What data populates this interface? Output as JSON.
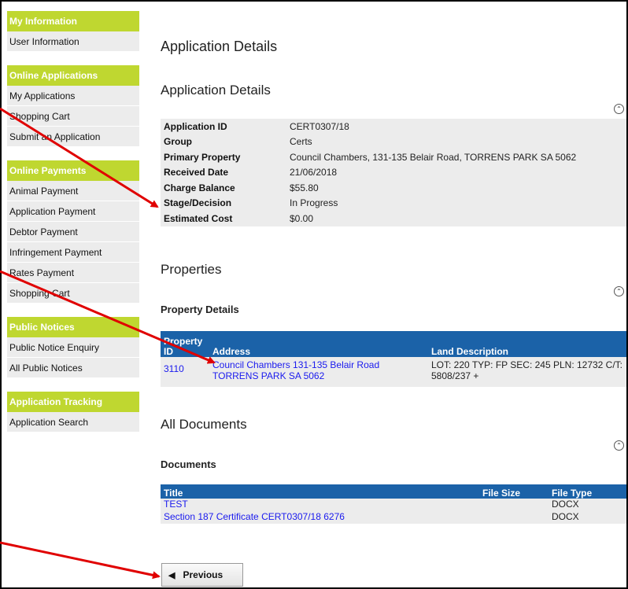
{
  "sidebar": {
    "groups": [
      {
        "title": "My Information",
        "items": [
          "User Information"
        ]
      },
      {
        "title": "Online Applications",
        "items": [
          "My Applications",
          "Shopping Cart",
          "Submit an Application"
        ]
      },
      {
        "title": "Online Payments",
        "items": [
          "Animal Payment",
          "Application Payment",
          "Debtor Payment",
          "Infringement Payment",
          "Rates Payment",
          "Shopping Cart"
        ]
      },
      {
        "title": "Public Notices",
        "items": [
          "Public Notice Enquiry",
          "All Public Notices"
        ]
      },
      {
        "title": "Application Tracking",
        "items": [
          "Application Search"
        ]
      }
    ]
  },
  "main": {
    "page_title": "Application Details",
    "details_heading": "Application Details",
    "details": [
      {
        "label": "Application ID",
        "value": "CERT0307/18"
      },
      {
        "label": "Group",
        "value": "Certs"
      },
      {
        "label": "Primary Property",
        "value": "Council Chambers, 131-135 Belair Road, TORRENS PARK SA 5062"
      },
      {
        "label": "Received Date",
        "value": "21/06/2018"
      },
      {
        "label": "Charge Balance",
        "value": "$55.80"
      },
      {
        "label": "Stage/Decision",
        "value": "In Progress"
      },
      {
        "label": "Estimated Cost",
        "value": "$0.00"
      }
    ],
    "properties_title": "Properties",
    "property_details_heading": "Property Details",
    "property_table": {
      "headers": [
        "Property ID",
        "Address",
        "Land Description"
      ],
      "rows": [
        {
          "id": "3110",
          "address": "Council Chambers 131-135 Belair Road TORRENS PARK SA 5062",
          "land": "LOT: 220 TYP: FP SEC: 245 PLN: 12732 C/T: 5808/237 +"
        }
      ]
    },
    "documents_title": "All Documents",
    "documents_heading": "Documents",
    "documents_table": {
      "headers": [
        "Title",
        "File Size",
        "File Type"
      ],
      "rows": [
        {
          "title": "TEST",
          "size": "",
          "type": "DOCX"
        },
        {
          "title": "Section 187 Certificate CERT0307/18 6276",
          "size": "",
          "type": "DOCX"
        }
      ]
    },
    "previous_label": "Previous"
  },
  "icons": {
    "collapse": "double-chevron-up-icon",
    "previous": "triangle-left-icon"
  },
  "colors": {
    "sidebar_header": "#bfd730",
    "table_header": "#1b62a8",
    "link": "#1a1aee",
    "annotation_arrow": "#e00000"
  }
}
